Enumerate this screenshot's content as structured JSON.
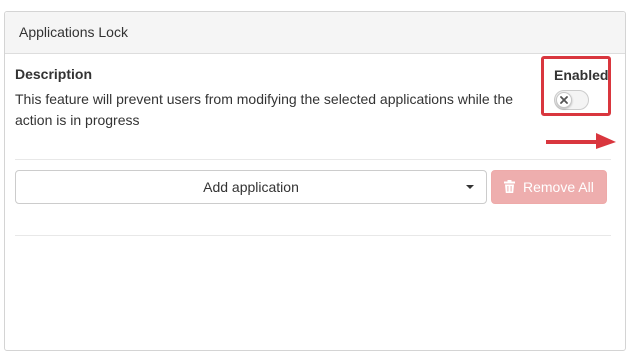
{
  "panel": {
    "title": "Applications Lock"
  },
  "description": {
    "title": "Description",
    "text": "This feature will prevent users from modifying the selected applications while the action is in progress"
  },
  "enabled": {
    "label": "Enabled",
    "toggle_state": "off",
    "toggle_knob_icon": "x-icon",
    "highlight_color": "#d9363e"
  },
  "annotation": {
    "arrow_color": "#d9363e",
    "arrow_icon": "right-arrow-icon"
  },
  "actions": {
    "dropdown_label": "Add application",
    "dropdown_icon": "caret-down-icon",
    "remove_label": "Remove All",
    "remove_icon": "trash-icon",
    "remove_disabled": true,
    "remove_color": "#eeaeae"
  }
}
